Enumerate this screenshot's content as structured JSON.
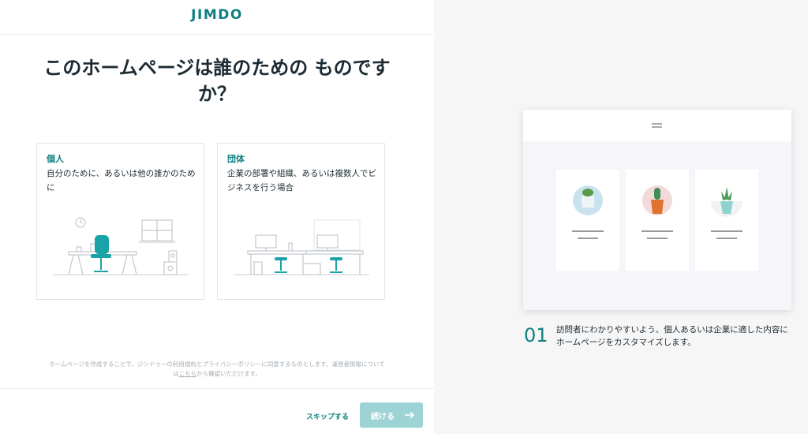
{
  "brand": {
    "logo": "JIMDO",
    "accent": "#0e7f80"
  },
  "page": {
    "headline": "このホームページは誰のための ものですか？"
  },
  "options": [
    {
      "title": "個人",
      "description": "自分のために、あるいは他の誰かのために",
      "illustration": "desk-single-person-icon"
    },
    {
      "title": "団体",
      "description": "企業の部署や組織、あるいは複数人でビジネスを行う場合",
      "illustration": "office-team-desks-icon"
    }
  ],
  "legal": {
    "line1": "ホームページを作成することで、ジンドゥーの利用規約とプライバシーポリシーに同意するものとします。運営者情報については",
    "link": "こちら",
    "line2": "から確認いただけます。"
  },
  "footer": {
    "skip_label": "スキップする",
    "continue_label": "続ける",
    "continue_color": "#9dd3d4"
  },
  "preview": {
    "step_number": "01",
    "step_text": "訪問者にわかりやすいよう、個人あるいは企業に適した内容にホームページをカスタマイズします。",
    "cards": [
      "cactus-pot-icon",
      "cactus-orange-pot-icon",
      "succulent-bowl-icon"
    ]
  }
}
